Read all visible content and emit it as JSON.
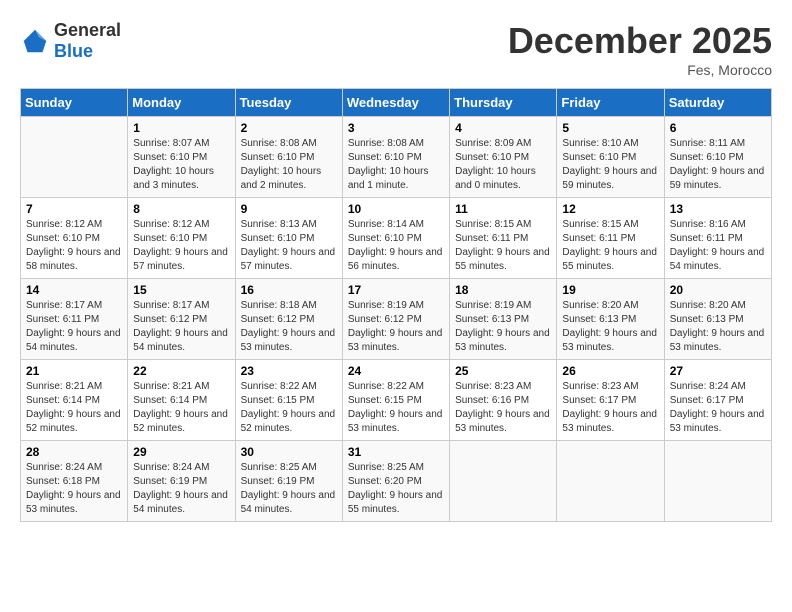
{
  "logo": {
    "general": "General",
    "blue": "Blue"
  },
  "header": {
    "month": "December 2025",
    "location": "Fes, Morocco"
  },
  "weekdays": [
    "Sunday",
    "Monday",
    "Tuesday",
    "Wednesday",
    "Thursday",
    "Friday",
    "Saturday"
  ],
  "weeks": [
    [
      {
        "day": "",
        "sunrise": "",
        "sunset": "",
        "daylight": ""
      },
      {
        "day": "1",
        "sunrise": "Sunrise: 8:07 AM",
        "sunset": "Sunset: 6:10 PM",
        "daylight": "Daylight: 10 hours and 3 minutes."
      },
      {
        "day": "2",
        "sunrise": "Sunrise: 8:08 AM",
        "sunset": "Sunset: 6:10 PM",
        "daylight": "Daylight: 10 hours and 2 minutes."
      },
      {
        "day": "3",
        "sunrise": "Sunrise: 8:08 AM",
        "sunset": "Sunset: 6:10 PM",
        "daylight": "Daylight: 10 hours and 1 minute."
      },
      {
        "day": "4",
        "sunrise": "Sunrise: 8:09 AM",
        "sunset": "Sunset: 6:10 PM",
        "daylight": "Daylight: 10 hours and 0 minutes."
      },
      {
        "day": "5",
        "sunrise": "Sunrise: 8:10 AM",
        "sunset": "Sunset: 6:10 PM",
        "daylight": "Daylight: 9 hours and 59 minutes."
      },
      {
        "day": "6",
        "sunrise": "Sunrise: 8:11 AM",
        "sunset": "Sunset: 6:10 PM",
        "daylight": "Daylight: 9 hours and 59 minutes."
      }
    ],
    [
      {
        "day": "7",
        "sunrise": "Sunrise: 8:12 AM",
        "sunset": "Sunset: 6:10 PM",
        "daylight": "Daylight: 9 hours and 58 minutes."
      },
      {
        "day": "8",
        "sunrise": "Sunrise: 8:12 AM",
        "sunset": "Sunset: 6:10 PM",
        "daylight": "Daylight: 9 hours and 57 minutes."
      },
      {
        "day": "9",
        "sunrise": "Sunrise: 8:13 AM",
        "sunset": "Sunset: 6:10 PM",
        "daylight": "Daylight: 9 hours and 57 minutes."
      },
      {
        "day": "10",
        "sunrise": "Sunrise: 8:14 AM",
        "sunset": "Sunset: 6:10 PM",
        "daylight": "Daylight: 9 hours and 56 minutes."
      },
      {
        "day": "11",
        "sunrise": "Sunrise: 8:15 AM",
        "sunset": "Sunset: 6:11 PM",
        "daylight": "Daylight: 9 hours and 55 minutes."
      },
      {
        "day": "12",
        "sunrise": "Sunrise: 8:15 AM",
        "sunset": "Sunset: 6:11 PM",
        "daylight": "Daylight: 9 hours and 55 minutes."
      },
      {
        "day": "13",
        "sunrise": "Sunrise: 8:16 AM",
        "sunset": "Sunset: 6:11 PM",
        "daylight": "Daylight: 9 hours and 54 minutes."
      }
    ],
    [
      {
        "day": "14",
        "sunrise": "Sunrise: 8:17 AM",
        "sunset": "Sunset: 6:11 PM",
        "daylight": "Daylight: 9 hours and 54 minutes."
      },
      {
        "day": "15",
        "sunrise": "Sunrise: 8:17 AM",
        "sunset": "Sunset: 6:12 PM",
        "daylight": "Daylight: 9 hours and 54 minutes."
      },
      {
        "day": "16",
        "sunrise": "Sunrise: 8:18 AM",
        "sunset": "Sunset: 6:12 PM",
        "daylight": "Daylight: 9 hours and 53 minutes."
      },
      {
        "day": "17",
        "sunrise": "Sunrise: 8:19 AM",
        "sunset": "Sunset: 6:12 PM",
        "daylight": "Daylight: 9 hours and 53 minutes."
      },
      {
        "day": "18",
        "sunrise": "Sunrise: 8:19 AM",
        "sunset": "Sunset: 6:13 PM",
        "daylight": "Daylight: 9 hours and 53 minutes."
      },
      {
        "day": "19",
        "sunrise": "Sunrise: 8:20 AM",
        "sunset": "Sunset: 6:13 PM",
        "daylight": "Daylight: 9 hours and 53 minutes."
      },
      {
        "day": "20",
        "sunrise": "Sunrise: 8:20 AM",
        "sunset": "Sunset: 6:13 PM",
        "daylight": "Daylight: 9 hours and 53 minutes."
      }
    ],
    [
      {
        "day": "21",
        "sunrise": "Sunrise: 8:21 AM",
        "sunset": "Sunset: 6:14 PM",
        "daylight": "Daylight: 9 hours and 52 minutes."
      },
      {
        "day": "22",
        "sunrise": "Sunrise: 8:21 AM",
        "sunset": "Sunset: 6:14 PM",
        "daylight": "Daylight: 9 hours and 52 minutes."
      },
      {
        "day": "23",
        "sunrise": "Sunrise: 8:22 AM",
        "sunset": "Sunset: 6:15 PM",
        "daylight": "Daylight: 9 hours and 52 minutes."
      },
      {
        "day": "24",
        "sunrise": "Sunrise: 8:22 AM",
        "sunset": "Sunset: 6:15 PM",
        "daylight": "Daylight: 9 hours and 53 minutes."
      },
      {
        "day": "25",
        "sunrise": "Sunrise: 8:23 AM",
        "sunset": "Sunset: 6:16 PM",
        "daylight": "Daylight: 9 hours and 53 minutes."
      },
      {
        "day": "26",
        "sunrise": "Sunrise: 8:23 AM",
        "sunset": "Sunset: 6:17 PM",
        "daylight": "Daylight: 9 hours and 53 minutes."
      },
      {
        "day": "27",
        "sunrise": "Sunrise: 8:24 AM",
        "sunset": "Sunset: 6:17 PM",
        "daylight": "Daylight: 9 hours and 53 minutes."
      }
    ],
    [
      {
        "day": "28",
        "sunrise": "Sunrise: 8:24 AM",
        "sunset": "Sunset: 6:18 PM",
        "daylight": "Daylight: 9 hours and 53 minutes."
      },
      {
        "day": "29",
        "sunrise": "Sunrise: 8:24 AM",
        "sunset": "Sunset: 6:19 PM",
        "daylight": "Daylight: 9 hours and 54 minutes."
      },
      {
        "day": "30",
        "sunrise": "Sunrise: 8:25 AM",
        "sunset": "Sunset: 6:19 PM",
        "daylight": "Daylight: 9 hours and 54 minutes."
      },
      {
        "day": "31",
        "sunrise": "Sunrise: 8:25 AM",
        "sunset": "Sunset: 6:20 PM",
        "daylight": "Daylight: 9 hours and 55 minutes."
      },
      {
        "day": "",
        "sunrise": "",
        "sunset": "",
        "daylight": ""
      },
      {
        "day": "",
        "sunrise": "",
        "sunset": "",
        "daylight": ""
      },
      {
        "day": "",
        "sunrise": "",
        "sunset": "",
        "daylight": ""
      }
    ]
  ]
}
